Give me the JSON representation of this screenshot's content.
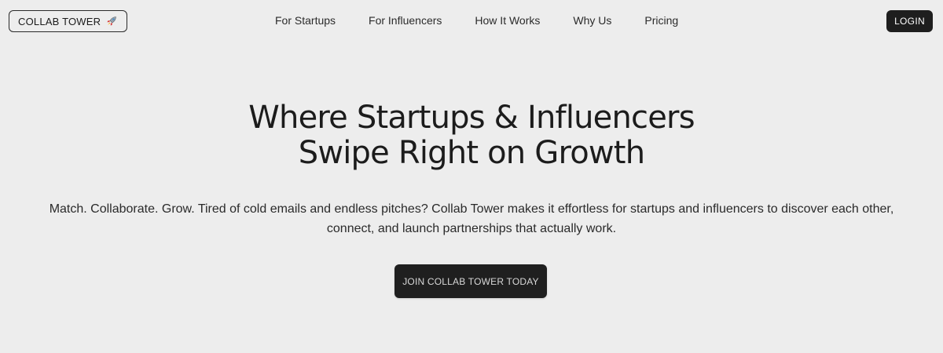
{
  "navbar": {
    "brand": {
      "label": "COLLAB TOWER",
      "icon": "rocket-icon"
    },
    "links": [
      {
        "label": "For Startups"
      },
      {
        "label": "For Influencers"
      },
      {
        "label": "How It Works"
      },
      {
        "label": "Why Us"
      },
      {
        "label": "Pricing"
      }
    ],
    "login_label": "LOGIN"
  },
  "hero": {
    "title_line_1": "Where Startups & Influencers",
    "title_line_2": "Swipe Right on Growth",
    "description": "Match. Collaborate. Grow. Tired of cold emails and endless pitches? Collab Tower makes it effortless for startups and influencers to discover each other, connect, and launch partnerships that actually work.",
    "cta_label": "JOIN COLLAB TOWER TODAY"
  },
  "colors": {
    "background": "#ededed",
    "text": "#1c1c1c",
    "button_dark": "#1e1e1e"
  }
}
